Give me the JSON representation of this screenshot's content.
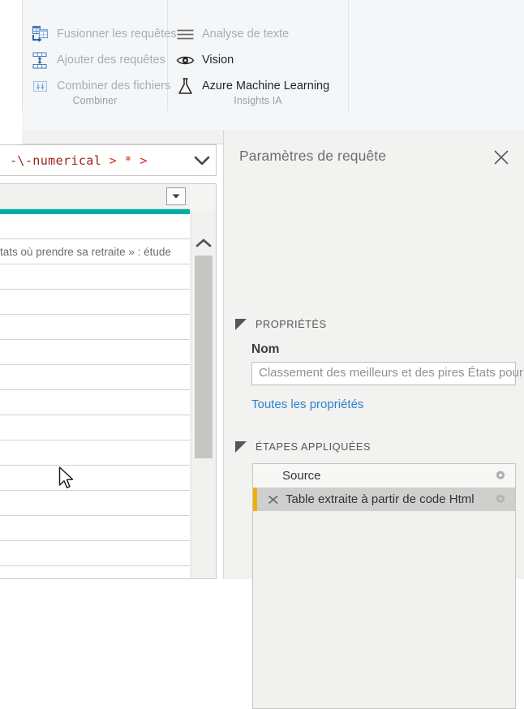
{
  "ribbon": {
    "groups": [
      {
        "name": "Combiner",
        "label": "Combiner",
        "items": [
          {
            "label": "Fusionner les requêtes",
            "icon": "merge-queries-icon",
            "enabled": false
          },
          {
            "label": "Ajouter des requêtes",
            "icon": "append-queries-icon",
            "enabled": false
          },
          {
            "label": "Combiner des fichiers",
            "icon": "combine-files-icon",
            "enabled": false
          }
        ]
      },
      {
        "name": "Insights IA",
        "label": "Insights IA",
        "items": [
          {
            "label": "Analyse de texte",
            "icon": "text-analytics-icon",
            "enabled": false
          },
          {
            "label": "Vision",
            "icon": "eye-icon",
            "enabled": true
          },
          {
            "label": "Azure Machine Learning",
            "icon": "flask-icon",
            "enabled": true
          }
        ]
      }
    ]
  },
  "formula": {
    "text_dark": "-\\-numerical",
    "text_bright": "> * >",
    "dropdown_icon": "chevron-down-icon"
  },
  "table": {
    "filter_icon": "filter-dropdown-icon",
    "scroll_up_icon": "chevron-up-icon",
    "accent_color": "#00b0a6",
    "rows": [
      {
        "cell": ""
      },
      {
        "cell": "tats où prendre sa retraite » : étude"
      },
      {
        "cell": ""
      },
      {
        "cell": ""
      },
      {
        "cell": ""
      },
      {
        "cell": ""
      },
      {
        "cell": ""
      },
      {
        "cell": ""
      },
      {
        "cell": ""
      },
      {
        "cell": ""
      },
      {
        "cell": ""
      },
      {
        "cell": ""
      },
      {
        "cell": ""
      },
      {
        "cell": ""
      },
      {
        "cell": ""
      }
    ]
  },
  "query_settings": {
    "title": "Paramètres de requête",
    "close_icon": "close-icon",
    "properties": {
      "section_label": "PROPRIÉTÉS",
      "collapse_icon": "triangle-collapse-icon",
      "name_label": "Nom",
      "name_value": "Classement des meilleurs et des pires États pour prendre sa retraite",
      "all_properties_link": "Toutes les propriétés",
      "link_color": "#2e7fd0"
    },
    "applied_steps": {
      "section_label": "ÉTAPES APPLIQUÉES",
      "collapse_icon": "triangle-collapse-icon",
      "steps": [
        {
          "label": "Source",
          "selected": false,
          "has_delete": false,
          "gear_icon": "gear-icon"
        },
        {
          "label": "Table extraite à partir de code Html",
          "selected": true,
          "has_delete": true,
          "delete_icon": "x-delete-icon",
          "gear_icon": "gear-icon"
        }
      ],
      "selection_marker_color": "#f0b000"
    }
  },
  "cursor": {
    "icon": "mouse-pointer-icon"
  }
}
